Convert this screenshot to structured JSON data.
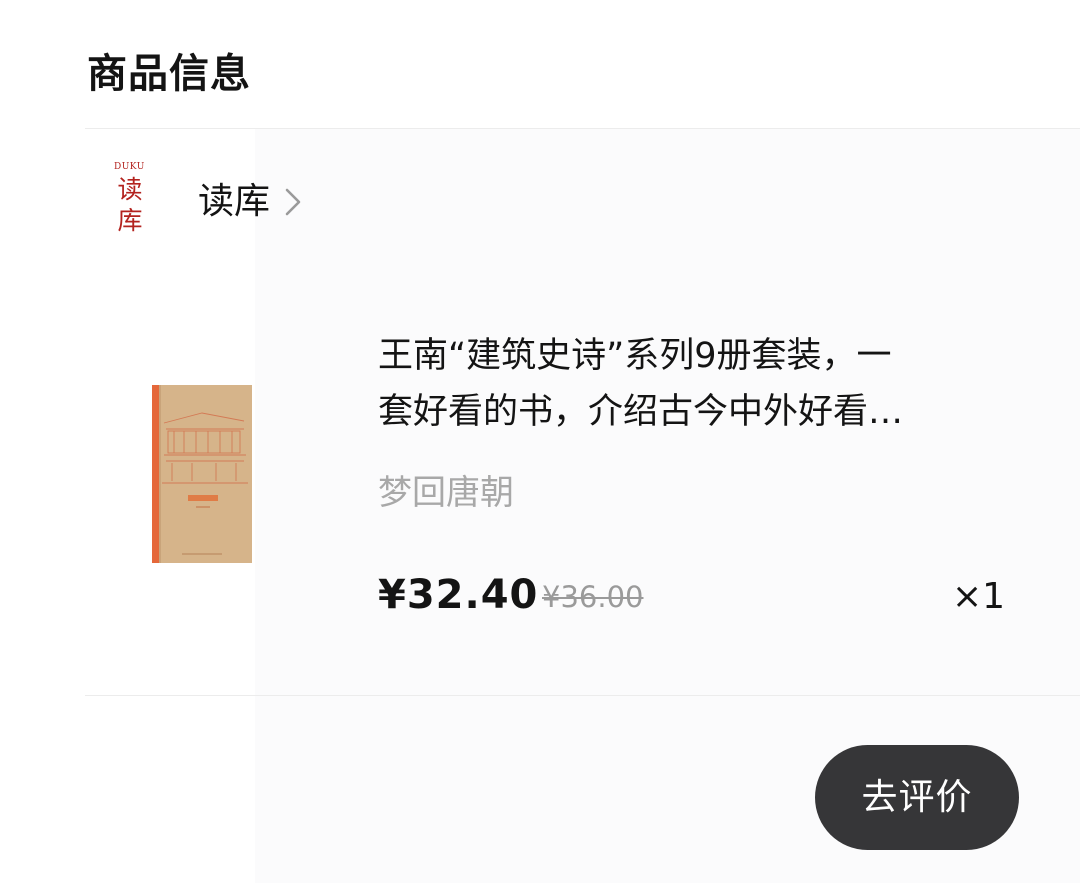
{
  "section": {
    "title": "商品信息"
  },
  "shop": {
    "logo_en": "DUKU",
    "logo_cn": "读库",
    "name": "读库",
    "chevron_icon": "chevron-right-icon"
  },
  "product": {
    "title_line1": "王南“建筑史诗”系列9册套装，一",
    "title_line2": "套好看的书，介绍古今中外好看…",
    "spec": "梦回唐朝",
    "price": "¥32.40",
    "original_price": "¥36.00",
    "quantity": "×1",
    "cover_icon": "book-cover-image"
  },
  "actions": {
    "review_label": "去评价"
  },
  "colors": {
    "brand_red": "#b3221e",
    "button_dark": "#363638",
    "muted_text": "#a8a8a8",
    "cover_paper": "#d7b58c",
    "cover_spine": "#e5683a"
  }
}
